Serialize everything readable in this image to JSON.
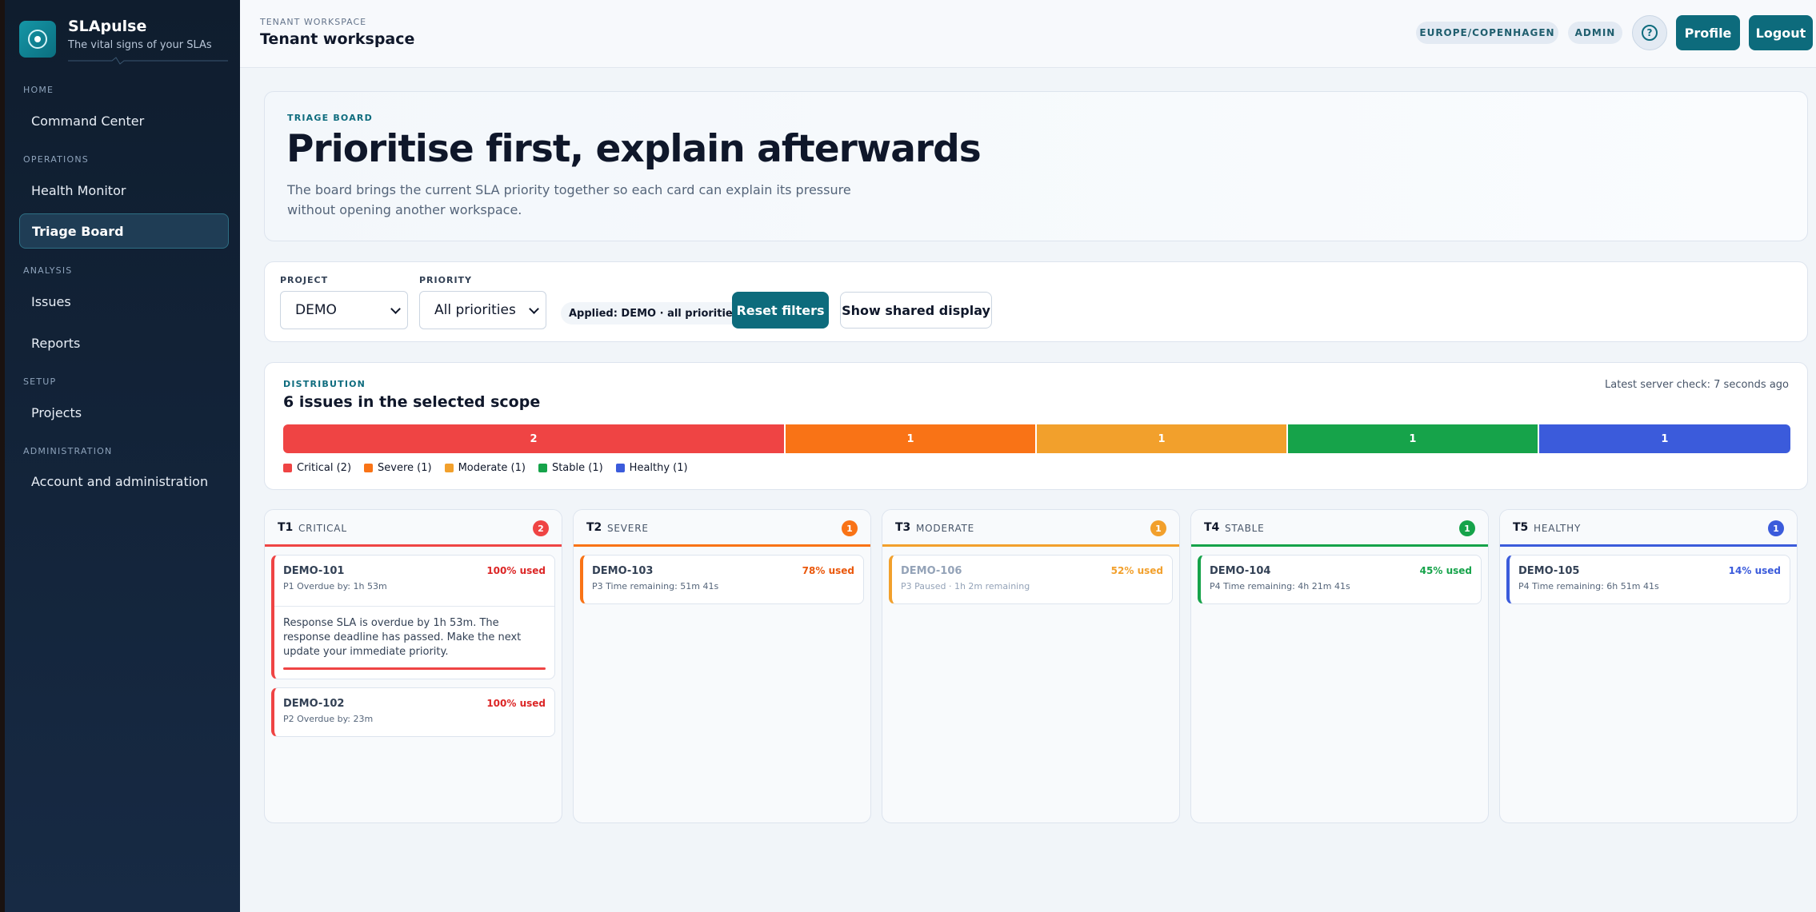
{
  "app": {
    "name": "SLApulse",
    "tagline": "The vital signs of your SLAs"
  },
  "sidebar": {
    "sections": [
      {
        "label": "HOME",
        "items": [
          {
            "label": "Command Center",
            "active": false
          }
        ]
      },
      {
        "label": "OPERATIONS",
        "items": [
          {
            "label": "Health Monitor",
            "active": false
          },
          {
            "label": "Triage Board",
            "active": true
          }
        ]
      },
      {
        "label": "ANALYSIS",
        "items": [
          {
            "label": "Issues",
            "active": false
          },
          {
            "label": "Reports",
            "active": false
          }
        ]
      },
      {
        "label": "SETUP",
        "items": [
          {
            "label": "Projects",
            "active": false
          }
        ]
      },
      {
        "label": "ADMINISTRATION",
        "items": [
          {
            "label": "Account and administration",
            "active": false
          }
        ]
      }
    ]
  },
  "header": {
    "eyebrow": "TENANT WORKSPACE",
    "title": "Tenant workspace",
    "timezone": "EUROPE/COPENHAGEN",
    "role": "ADMIN",
    "help_icon": "question-circle-icon",
    "profile_label": "Profile",
    "logout_label": "Logout"
  },
  "hero": {
    "eyebrow": "TRIAGE BOARD",
    "title": "Prioritise first, explain afterwards",
    "description": "The board brings the current SLA priority together so each card can explain its pressure without opening another workspace."
  },
  "filters": {
    "project_label": "PROJECT",
    "project_value": "DEMO",
    "priority_label": "PRIORITY",
    "priority_value": "All priorities",
    "applied": "Applied: DEMO · all priorities",
    "reset_label": "Reset filters",
    "shared_label": "Show shared display"
  },
  "distribution": {
    "eyebrow": "DISTRIBUTION",
    "title": "6 issues in the selected scope",
    "server_check": "Latest server check: 7 seconds ago",
    "segments": [
      {
        "label": "Critical (2)",
        "count": 2,
        "color": "#ef4444"
      },
      {
        "label": "Severe (1)",
        "count": 1,
        "color": "#f97316"
      },
      {
        "label": "Moderate (1)",
        "count": 1,
        "color": "#f2a02c"
      },
      {
        "label": "Stable (1)",
        "count": 1,
        "color": "#16a34a"
      },
      {
        "label": "Healthy (1)",
        "count": 1,
        "color": "#3b5bdb"
      }
    ]
  },
  "columns": [
    {
      "code": "T1",
      "name": "CRITICAL",
      "count": 2,
      "color": "#ef4444",
      "text_color": "#dc2626",
      "issues": [
        {
          "key": "DEMO-101",
          "used": "100% used",
          "meta": "P1   Overdue by: 1h 53m",
          "description": "Response SLA is overdue by 1h 53m. The response deadline has passed. Make the next update your immediate priority.",
          "progress": 1.0,
          "muted": false
        },
        {
          "key": "DEMO-102",
          "used": "100% used",
          "meta": "P2   Overdue by: 23m",
          "muted": false
        }
      ]
    },
    {
      "code": "T2",
      "name": "SEVERE",
      "count": 1,
      "color": "#f97316",
      "text_color": "#ea580c",
      "issues": [
        {
          "key": "DEMO-103",
          "used": "78% used",
          "meta": "P3   Time remaining: 51m 41s",
          "muted": false
        }
      ]
    },
    {
      "code": "T3",
      "name": "MODERATE",
      "count": 1,
      "color": "#f2a02c",
      "text_color": "#f2a02c",
      "issues": [
        {
          "key": "DEMO-106",
          "used": "52% used",
          "meta": "P3   Paused · 1h 2m remaining",
          "muted": true
        }
      ]
    },
    {
      "code": "T4",
      "name": "STABLE",
      "count": 1,
      "color": "#16a34a",
      "text_color": "#16a34a",
      "issues": [
        {
          "key": "DEMO-104",
          "used": "45% used",
          "meta": "P4   Time remaining: 4h 21m 41s",
          "muted": false
        }
      ]
    },
    {
      "code": "T5",
      "name": "HEALTHY",
      "count": 1,
      "color": "#3b5bdb",
      "text_color": "#3b5bdb",
      "issues": [
        {
          "key": "DEMO-105",
          "used": "14% used",
          "meta": "P4   Time remaining: 6h 51m 41s",
          "muted": false
        }
      ]
    }
  ]
}
